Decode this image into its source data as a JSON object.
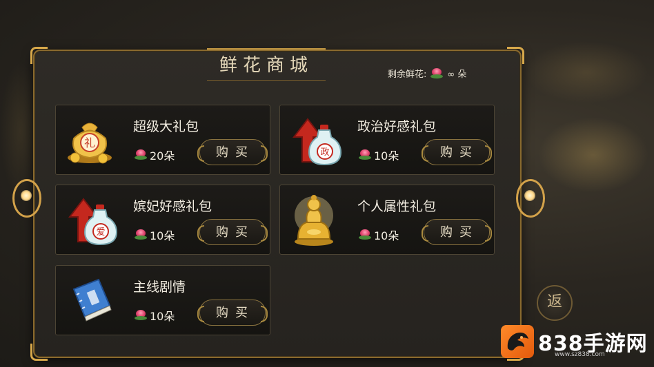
{
  "shop": {
    "title": "鲜花商城",
    "remaining_label": "剩余鲜花:",
    "remaining_value": "∞ 朵"
  },
  "items": [
    {
      "name": "超级大礼包",
      "price": "20朵",
      "buy_label": "购买",
      "icon": "gift-bag-icon"
    },
    {
      "name": "政治好感礼包",
      "price": "10朵",
      "buy_label": "购买",
      "icon": "politics-bottle-icon"
    },
    {
      "name": "嫔妃好感礼包",
      "price": "10朵",
      "buy_label": "购买",
      "icon": "love-bottle-icon"
    },
    {
      "name": "个人属性礼包",
      "price": "10朵",
      "buy_label": "购买",
      "icon": "golden-buddha-icon"
    },
    {
      "name": "主线剧情",
      "price": "10朵",
      "buy_label": "购买",
      "icon": "blue-book-icon"
    }
  ],
  "icon_glyphs": {
    "gift": "礼",
    "politics": "政",
    "love": "爱"
  },
  "back_label": "返",
  "watermark": {
    "text": "838手游网",
    "url": "www.sz838.com"
  },
  "colors": {
    "gold_accent": "#d7a84a",
    "panel_bg": "#2b2823",
    "text": "#f1ece0"
  }
}
